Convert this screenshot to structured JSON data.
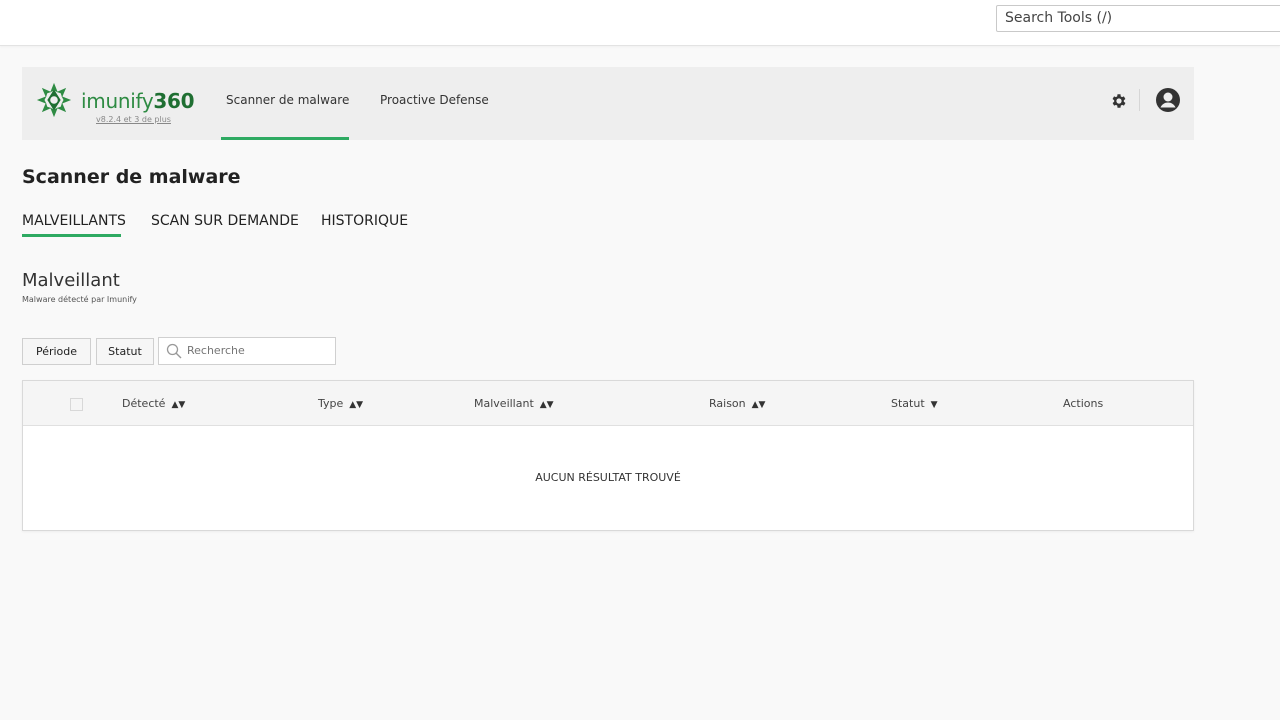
{
  "topbar": {
    "search_text": "Search Tools (/)"
  },
  "app": {
    "logo_name": "imunify",
    "logo_number": "360",
    "version": "v8.2.4 et 3 de plus",
    "nav": [
      {
        "label": "Scanner de malware",
        "active": true
      },
      {
        "label": "Proactive Defense",
        "active": false
      }
    ],
    "accent_color": "#2eaa62",
    "brand_color": "#2e8b43"
  },
  "page": {
    "title": "Scanner de malware",
    "tabs": [
      {
        "label": "MALVEILLANTS",
        "active": true
      },
      {
        "label": "SCAN SUR DEMANDE",
        "active": false
      },
      {
        "label": "HISTORIQUE",
        "active": false
      }
    ]
  },
  "section": {
    "title": "Malveillant",
    "subtitle": "Malware détecté par Imunify"
  },
  "filters": {
    "period_label": "Période",
    "status_label": "Statut",
    "search_placeholder": "Recherche"
  },
  "table": {
    "columns": [
      {
        "label": "Détecté",
        "sort": "both"
      },
      {
        "label": "Type",
        "sort": "both"
      },
      {
        "label": "Malveillant",
        "sort": "both"
      },
      {
        "label": "Raison",
        "sort": "both"
      },
      {
        "label": "Statut",
        "sort": "down"
      },
      {
        "label": "Actions",
        "sort": "none"
      }
    ],
    "empty_message": "AUCUN RÉSULTAT TROUVÉ"
  }
}
